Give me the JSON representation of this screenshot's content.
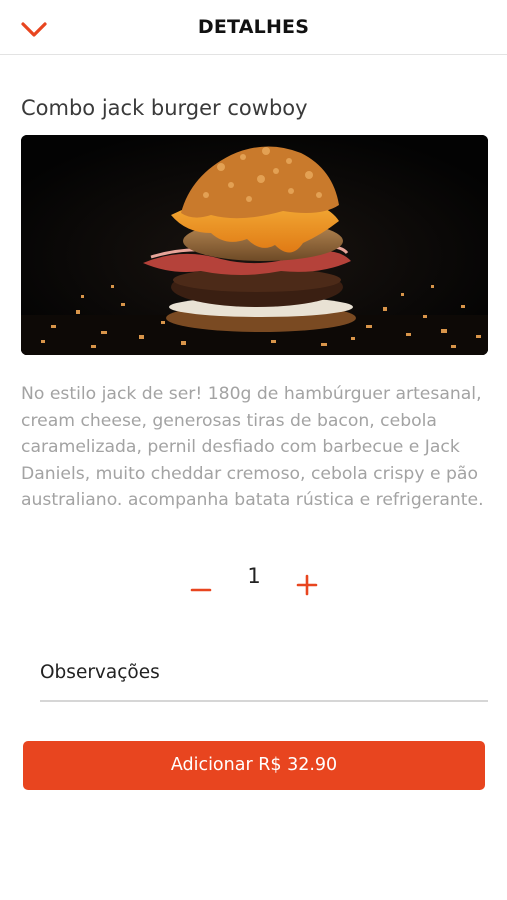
{
  "colors": {
    "accent": "#e8451f",
    "text_dark": "#2b2b2b",
    "text_muted": "#a3a3a3",
    "divider": "#e3e3e3"
  },
  "header": {
    "title": "DETALHES",
    "back_icon": "chevron-down-icon"
  },
  "product": {
    "title": "Combo jack burger cowboy",
    "description": "No estilo jack de ser! 180g de hambúrguer artesanal, cream cheese, generosas tiras de bacon, cebola caramelizada, pernil desfiado com barbecue e Jack Daniels, muito cheddar cremoso, cebola crispy e pão australiano. acompanha batata rústica e refrigerante."
  },
  "quantity": {
    "value": "1",
    "minus_icon": "minus-icon",
    "plus_icon": "plus-icon"
  },
  "notes": {
    "placeholder": "Observações"
  },
  "add_button": {
    "label": "Adicionar R$ 32.90"
  }
}
